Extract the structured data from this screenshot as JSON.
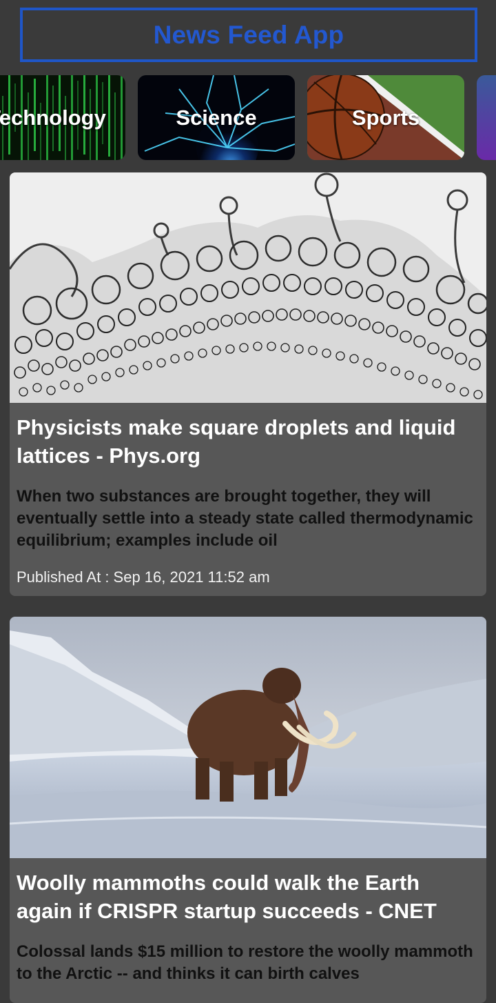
{
  "header": {
    "title": "News Feed App",
    "accent_color": "#1f56c8"
  },
  "categories": [
    {
      "label": "Technology",
      "image": "matrix-code"
    },
    {
      "label": "Science",
      "image": "plasma-ball"
    },
    {
      "label": "Sports",
      "image": "basketball-on-court"
    },
    {
      "label": "",
      "image": "purple-gradient"
    }
  ],
  "articles": [
    {
      "image": "liquid-lattice-droplets",
      "title": "Physicists make square droplets and liquid lattices - Phys.org",
      "description": "When two substances are brought together, they will eventually settle into a steady state called thermodynamic equilibrium; examples include oil",
      "published_label": "Published At :",
      "published_value": "Sep 16, 2021 11:52 am"
    },
    {
      "image": "woolly-mammoth-in-snow",
      "title": "Woolly mammoths could walk the Earth again if CRISPR startup succeeds - CNET",
      "description": "Colossal lands $15 million to restore the woolly mammoth to the Arctic -- and thinks it can birth calves"
    }
  ]
}
